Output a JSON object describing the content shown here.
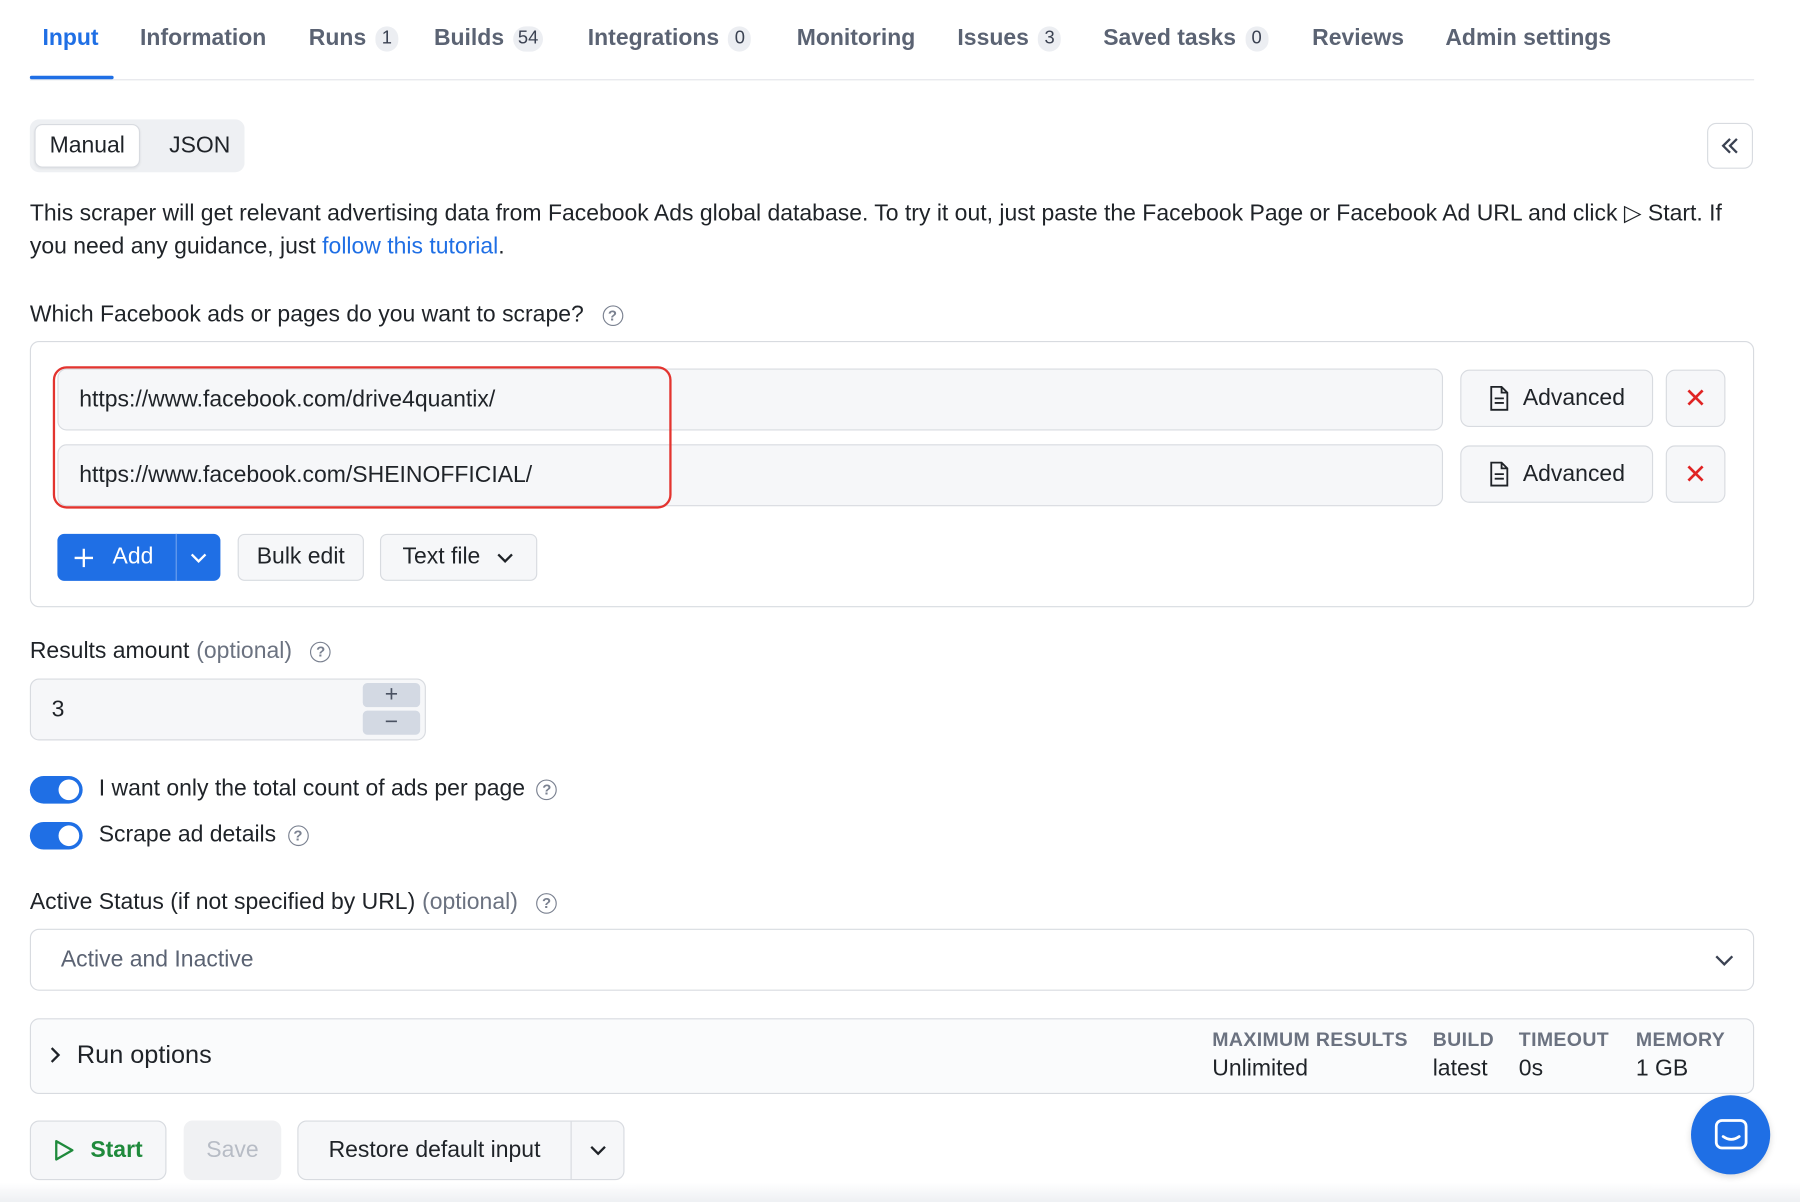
{
  "tabs": [
    {
      "label": "Input"
    },
    {
      "label": "Information"
    },
    {
      "label": "Runs",
      "count": "1"
    },
    {
      "label": "Builds",
      "count": "54"
    },
    {
      "label": "Integrations",
      "count": "0"
    },
    {
      "label": "Monitoring"
    },
    {
      "label": "Issues",
      "count": "3"
    },
    {
      "label": "Saved tasks",
      "count": "0"
    },
    {
      "label": "Reviews"
    },
    {
      "label": "Admin settings"
    }
  ],
  "mode": {
    "manual": "Manual",
    "json": "JSON"
  },
  "description": {
    "text1": "This scraper will get relevant advertising data from Facebook Ads global database. To try it out, just paste the Facebook Page or Facebook Ad URL and click ▷ Start. If you need any guidance, just ",
    "link": "follow this tutorial",
    "text2": "."
  },
  "urls_section": {
    "label": "Which Facebook ads or pages do you want to scrape?",
    "urls": [
      "https://www.facebook.com/drive4quantix/",
      "https://www.facebook.com/SHEINOFFICIAL/"
    ],
    "advanced_label": "Advanced",
    "add_label": "Add",
    "bulk_edit_label": "Bulk edit",
    "text_file_label": "Text file"
  },
  "results_amount": {
    "label": "Results amount",
    "optional": "(optional)",
    "value": "3"
  },
  "toggles": [
    {
      "label": "I want only the total count of ads per page",
      "on": true
    },
    {
      "label": "Scrape ad details",
      "on": true
    }
  ],
  "active_status": {
    "label": "Active Status (if not specified by URL)",
    "optional": "(optional)",
    "value": "Active and Inactive"
  },
  "run_options": {
    "title": "Run options",
    "meta": [
      {
        "key": "MAXIMUM RESULTS",
        "value": "Unlimited"
      },
      {
        "key": "BUILD",
        "value": "latest"
      },
      {
        "key": "TIMEOUT",
        "value": "0s"
      },
      {
        "key": "MEMORY",
        "value": "1 GB"
      }
    ]
  },
  "actions": {
    "start": "Start",
    "save": "Save",
    "restore": "Restore default input"
  },
  "colors": {
    "accent": "#1f6fe5",
    "danger": "#e02424",
    "success": "#1f8a3c"
  }
}
